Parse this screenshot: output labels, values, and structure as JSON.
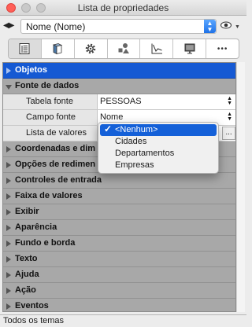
{
  "window": {
    "title": "Lista de propriedades"
  },
  "object_selector": {
    "value": "Nome (Nome)"
  },
  "toolbar": {
    "tabs": [
      {
        "icon": "properties-list-icon",
        "active": true
      },
      {
        "icon": "book-icon",
        "active": false
      },
      {
        "icon": "gear-icon",
        "active": false
      },
      {
        "icon": "shapes-icon",
        "active": false
      },
      {
        "icon": "line-chart-icon",
        "active": false
      },
      {
        "icon": "monitor-icon",
        "active": false
      },
      {
        "icon": "more-icon",
        "active": false
      }
    ],
    "more_label": "•••"
  },
  "grid": {
    "selected_category": "Objetos",
    "open_category": "Fonte de dados",
    "categories_top": [
      "Objetos",
      "Fonte de dados"
    ],
    "properties": [
      {
        "name": "Tabela fonte",
        "value": "PESSOAS"
      },
      {
        "name": "Campo fonte",
        "value": "Nome"
      },
      {
        "name": "Lista de valores",
        "value": ""
      }
    ],
    "categories_bottom": [
      "Coordenadas e dim",
      "Opções de redimen",
      "Controles de entrada",
      "Faixa de valores",
      "Exibir",
      "Aparência",
      "Fundo e borda",
      "Texto",
      "Ajuda",
      "Ação",
      "Eventos"
    ]
  },
  "popup": {
    "options": [
      "<Nenhum>",
      "Cidades",
      "Departamentos",
      "Empresas"
    ],
    "selected": "<Nenhum>"
  },
  "ellipsis_label": "...",
  "status": {
    "text": "Todos os temas"
  },
  "colors": {
    "selection": "#1559d3",
    "category": "#a8a8a8",
    "close": "#ff5f57"
  }
}
